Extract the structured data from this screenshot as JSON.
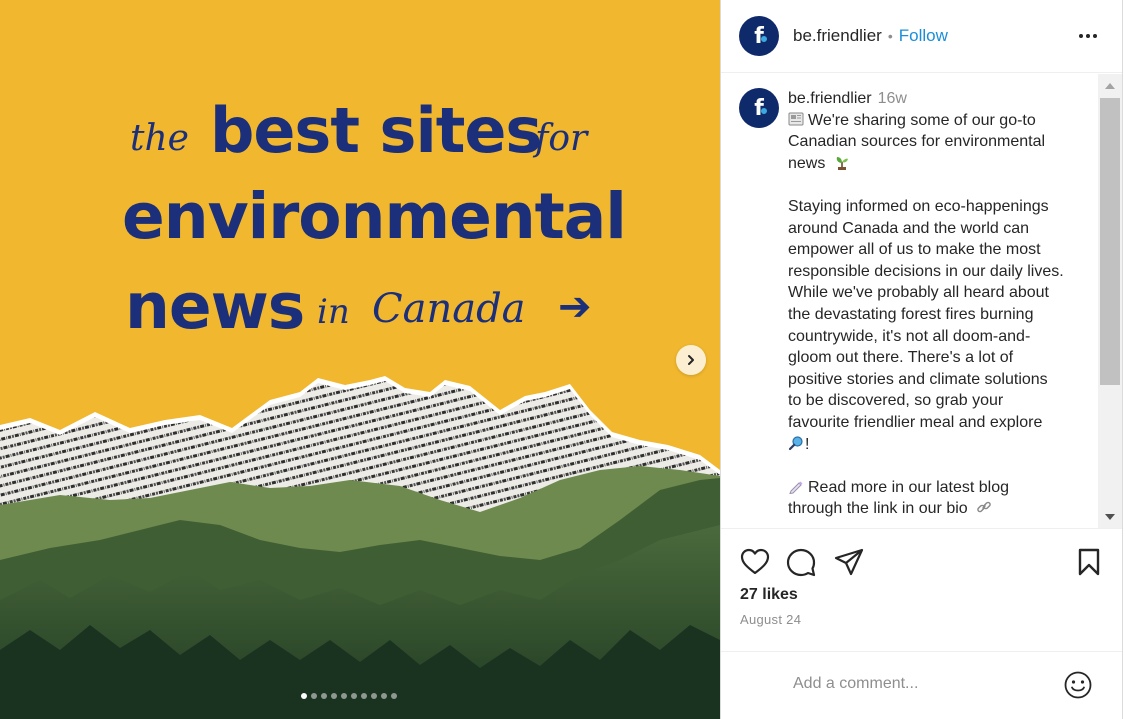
{
  "media": {
    "headline": {
      "word1": "the",
      "word2": "best sites",
      "word3": "for",
      "word4": "environmental",
      "word5": "news",
      "word6": "in",
      "word7": "Canada",
      "arrow": "➔"
    },
    "carousel": {
      "slide_count": 10,
      "active_index": 0
    }
  },
  "header": {
    "username": "be.friendlier",
    "separator": "•",
    "follow_label": "Follow"
  },
  "caption": {
    "username": "be.friendlier",
    "time": "16w",
    "lines": [
      "We're sharing some of our go-to",
      "Canadian sources for environmental",
      "news",
      "",
      "Staying informed on eco-happenings",
      "around Canada and the world can",
      "empower all of us to make the most",
      "responsible decisions in our daily lives.",
      "While we've probably all heard about",
      "the devastating forest fires burning",
      "countrywide, it's not all doom-and-",
      "gloom out there. There's a lot of",
      "positive stories and climate solutions",
      "to be discovered, so grab your",
      "favourite friendlier meal and explore",
      "!",
      "",
      "Read more in our latest blog",
      "through the link in our bio"
    ]
  },
  "actions": {
    "like_icon": "heart-icon",
    "comment_icon": "comment-icon",
    "share_icon": "paper-plane-icon",
    "save_icon": "bookmark-icon"
  },
  "likes": "27 likes",
  "date": "August 24",
  "comment": {
    "placeholder": "Add a comment..."
  },
  "colors": {
    "media_background": "#f0b72f",
    "headline_text": "#1b2f7a",
    "follow_link": "#1a8fd9",
    "avatar": "#0f2a6b"
  }
}
